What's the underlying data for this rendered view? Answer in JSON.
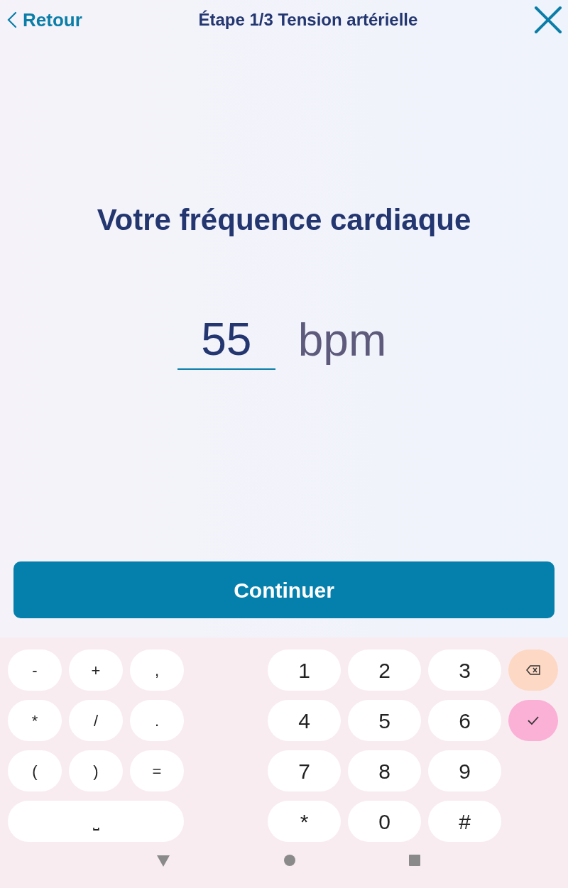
{
  "header": {
    "back_label": "Retour",
    "title": "Étape 1/3 Tension artérielle"
  },
  "heading": "Votre fréquence cardiaque",
  "field": {
    "value": "55",
    "unit": "bpm"
  },
  "continue_button": "Continuer",
  "keyboard": {
    "symbol_keys": [
      "-",
      "+",
      ",",
      "*",
      "/",
      ".",
      "(",
      ")",
      "="
    ],
    "space_key": "⎵",
    "digit_keys": [
      "1",
      "2",
      "3",
      "4",
      "5",
      "6",
      "7",
      "8",
      "9",
      "*",
      "0",
      "#"
    ]
  }
}
